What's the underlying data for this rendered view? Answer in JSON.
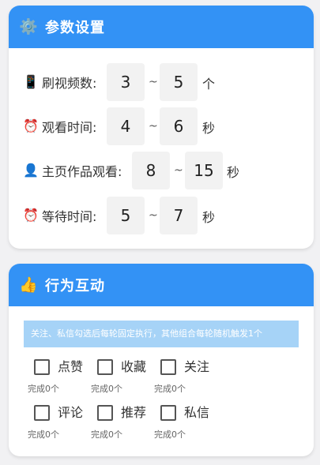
{
  "params": {
    "title": "参数设置",
    "header_icon": "⚙️",
    "separator": "~",
    "rows": [
      {
        "icon": "📱",
        "label": "刷视频数:",
        "min": "3",
        "max": "5",
        "unit": "个"
      },
      {
        "icon": "⏰",
        "label": "观看时间:",
        "min": "4",
        "max": "6",
        "unit": "秒"
      },
      {
        "icon": "👤",
        "label": "主页作品观看:",
        "min": "8",
        "max": "15",
        "unit": "秒"
      },
      {
        "icon": "⏰",
        "label": "等待时间:",
        "min": "5",
        "max": "7",
        "unit": "秒"
      }
    ]
  },
  "actions": {
    "title": "行为互动",
    "header_icon": "👍",
    "notice": "关注、私信勾选后每轮固定执行，其他组合每轮随机触发1个",
    "options": [
      {
        "label": "点赞",
        "status": "完成0个",
        "checked": false
      },
      {
        "label": "收藏",
        "status": "完成0个",
        "checked": false
      },
      {
        "label": "关注",
        "status": "完成0个",
        "checked": false
      },
      {
        "label": "评论",
        "status": "完成0个",
        "checked": false
      },
      {
        "label": "推荐",
        "status": "完成0个",
        "checked": false
      },
      {
        "label": "私信",
        "status": "完成0个",
        "checked": false
      }
    ]
  },
  "colors": {
    "header_blue": "#3392f5",
    "notice_blue": "#a6d3f7",
    "page_bg": "#f1f1f3",
    "input_bg": "#f2f2f2"
  }
}
